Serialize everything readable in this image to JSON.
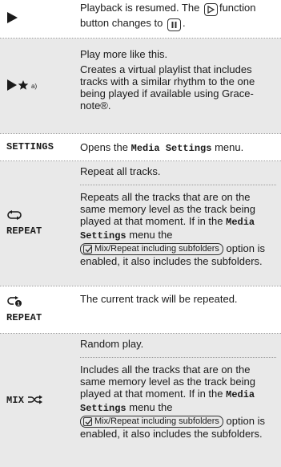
{
  "rows": {
    "play": {
      "icon": "play-icon",
      "text_before": "Playback is resumed. The",
      "text_middle": "function button changes to",
      "text_after": "."
    },
    "more_like_this": {
      "icon": "play-star-icon",
      "footnote": "a)",
      "line1": "Play more like this.",
      "line2": "Creates a virtual playlist that includes tracks with a similar rhythm to the one being played if available using Grace-note®."
    },
    "settings": {
      "label": "SETTINGS",
      "text_before": "Opens the",
      "keyword": "Media Settings",
      "text_after": "menu."
    },
    "repeat_all": {
      "icon": "repeat-all-icon",
      "label": "REPEAT",
      "line1": "Repeat all tracks.",
      "para_before": "Repeats all the tracks that are on the same memory level as the track being played at that moment. If in the",
      "keyword": "Media Settings",
      "para_middle": "menu the",
      "option": "Mix/Repeat including subfolders",
      "para_after": "option is enabled, it also includes the subfolders."
    },
    "repeat_one": {
      "icon": "repeat-one-icon",
      "label": "REPEAT",
      "text": "The current track will be repeated."
    },
    "mix": {
      "label": "MIX",
      "icon": "shuffle-icon",
      "line1": "Random play.",
      "para_before": "Includes all the tracks that are on the same memory level as the track being played at that moment. If in the",
      "keyword": "Media Settings",
      "para_middle": "menu the",
      "option": "Mix/Repeat including subfolders",
      "para_after": "option is enabled, it also includes the subfolders."
    }
  }
}
